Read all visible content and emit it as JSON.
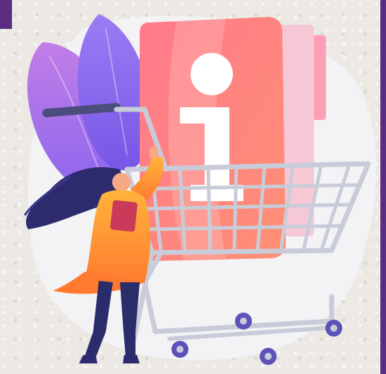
{
  "illustration": {
    "subject": "person-with-shopping-cart-and-info-book",
    "book_glyph": "i",
    "colors": {
      "frame_accent": "#5a2d83",
      "book": "#ff6f86",
      "book_pages": "#f6c8d6",
      "cart": "#c8ccd8",
      "wheels": "#5d52b8",
      "person_top": "#ffa938",
      "person_hair": "#2d2b6e",
      "person_pants": "#2a2d6a",
      "leaves": "#a97ef0",
      "backdrop": "#f4f3f5"
    }
  }
}
